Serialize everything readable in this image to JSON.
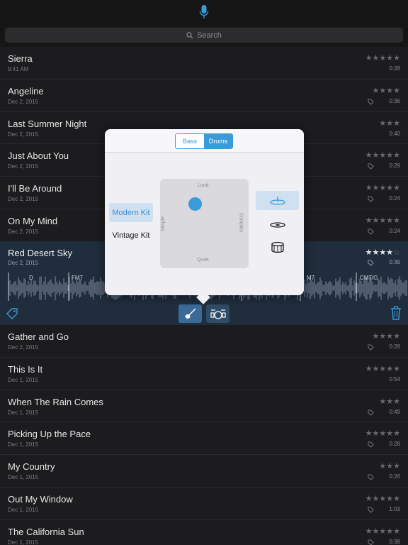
{
  "search": {
    "placeholder": "Search"
  },
  "songs_top": [
    {
      "title": "Sierra",
      "date": "9:41 AM",
      "stars": "★★★★★",
      "duration": "0:28",
      "tag": false
    },
    {
      "title": "Angeline",
      "date": "Dec 2, 2015",
      "stars": "★★★★",
      "duration": "0:36",
      "tag": true
    },
    {
      "title": "Last Summer Night",
      "date": "Dec 2, 2015",
      "stars": "★★★",
      "duration": "0:40",
      "tag": false
    },
    {
      "title": "Just About You",
      "date": "Dec 2, 2015",
      "stars": "★★★★★",
      "duration": "0:29",
      "tag": true
    },
    {
      "title": "I'll Be Around",
      "date": "Dec 2, 2015",
      "stars": "★★★★★",
      "duration": "0:24",
      "tag": true
    },
    {
      "title": "On My Mind",
      "date": "Dec 2, 2015",
      "stars": "★★★★★",
      "duration": "0:24",
      "tag": true
    }
  ],
  "selected_song": {
    "title": "Red Desert Sky",
    "date": "Dec 2, 2015",
    "rating": 4,
    "stars_on": "★★★★",
    "stars_off": "☆",
    "duration": "0:39",
    "chords": [
      "D",
      "FM7",
      "M7",
      "CM7/G"
    ]
  },
  "songs_bottom": [
    {
      "title": "Gather and Go",
      "date": "Dec 2, 2015",
      "stars": "★★★★",
      "duration": "0:28",
      "tag": true
    },
    {
      "title": "This Is It",
      "date": "Dec 1, 2015",
      "stars": "★★★★★",
      "duration": "0:54",
      "tag": false
    },
    {
      "title": "When The Rain Comes",
      "date": "Dec 1, 2015",
      "stars": "★★★",
      "duration": "0:49",
      "tag": true
    },
    {
      "title": "Picking Up the Pace",
      "date": "Dec 1, 2015",
      "stars": "★★★★★",
      "duration": "0:28",
      "tag": true
    },
    {
      "title": "My Country",
      "date": "Dec 1, 2015",
      "stars": "★★★",
      "duration": "0:26",
      "tag": true
    },
    {
      "title": "Out My Window",
      "date": "Dec 1, 2015",
      "stars": "★★★★★",
      "duration": "1:03",
      "tag": true
    },
    {
      "title": "The California Sun",
      "date": "Dec 1, 2015",
      "stars": "★★★★★",
      "duration": "0:38",
      "tag": true
    }
  ],
  "popover": {
    "segments": [
      "Bass",
      "Drums"
    ],
    "selected_segment": "Drums",
    "kits": [
      "Modern Kit",
      "Vintage Kit"
    ],
    "selected_kit": "Modern Kit",
    "pad": {
      "top": "Loud",
      "bottom": "Quiet",
      "left": "Simple",
      "right": "Complex"
    },
    "pieces": [
      "cymbal-icon",
      "hihat-icon",
      "snare-drum-icon"
    ],
    "selected_piece": "cymbal-icon"
  },
  "colors": {
    "accent": "#3b9ad8",
    "selected_row": "#1f2d3d",
    "background": "#1c1c1e"
  }
}
